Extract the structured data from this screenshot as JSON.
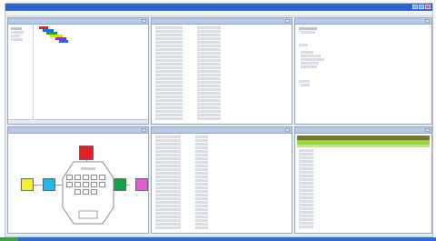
{
  "colors": {
    "title_bar": "#2f63c6",
    "pane_header": "#b8c9e3",
    "red": "#e0202a",
    "blue": "#1c6fd0",
    "yellow": "#f2ef35",
    "cyan": "#25b6e6",
    "green": "#12a24a",
    "magenta": "#e35ad0",
    "olive_bar": "#6e7d2b",
    "lime_bar": "#9bd24a"
  },
  "icons": {
    "minimize": "minimize-icon",
    "maximize": "maximize-icon",
    "close": "close-icon"
  }
}
